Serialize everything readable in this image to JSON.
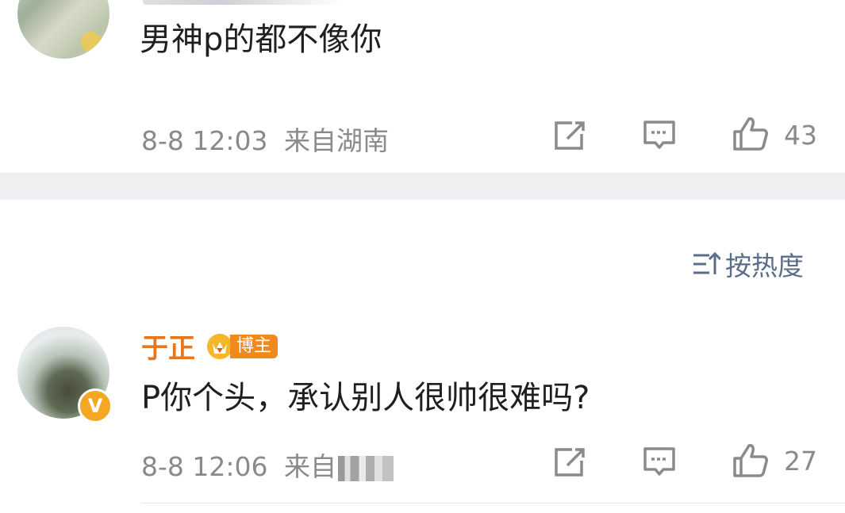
{
  "comments": [
    {
      "text": "男神p的都不像你",
      "time": "8-8 12:03",
      "location": "来自湖南",
      "likes": "43"
    },
    {
      "username": "于正",
      "badge": "博主",
      "text": "P你个头，承认别人很帅很难吗?",
      "time": "8-8 12:06",
      "location": "来自",
      "likes": "27"
    }
  ],
  "sort_label": "按热度",
  "icons": [
    "repost-icon",
    "comment-icon",
    "like-icon",
    "sort-icon",
    "crown-icon",
    "verified-icon"
  ],
  "colors": {
    "username": "#e8761c",
    "sort": "#5a6e8a",
    "meta": "#8a8a8a",
    "badge": "#f08a1c"
  }
}
